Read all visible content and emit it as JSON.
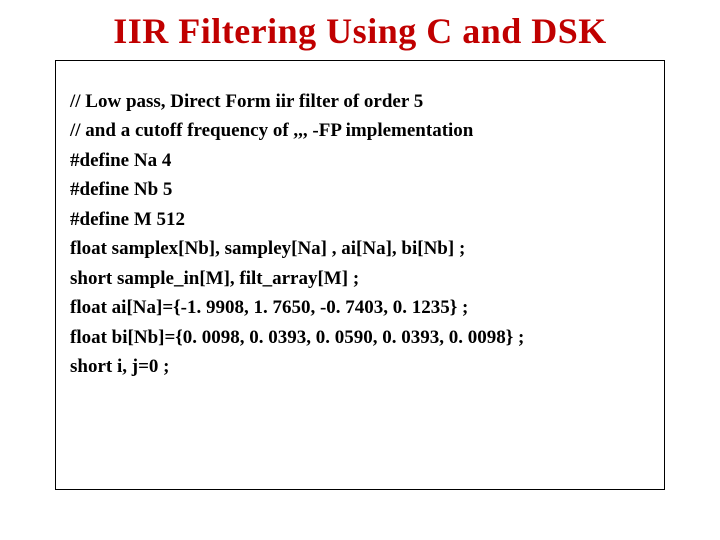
{
  "title": "IIR Filtering Using C and DSK",
  "code": {
    "l0": "// Low pass, Direct Form iir filter of order 5",
    "l1": "// and a cutoff frequency of ,,, -FP implementation",
    "l2": "#define Na 4",
    "l3": "#define Nb 5",
    "l4": "#define M 512",
    "l5": "float samplex[Nb], sampley[Na] , ai[Na], bi[Nb] ;",
    "l6": "short sample_in[M], filt_array[M] ;",
    "l7": "float ai[Na]={-1. 9908, 1. 7650, -0. 7403, 0. 1235} ;",
    "l8": "float bi[Nb]={0. 0098, 0. 0393, 0. 0590, 0. 0393, 0. 0098} ;",
    "l9": "short i, j=0 ;"
  }
}
